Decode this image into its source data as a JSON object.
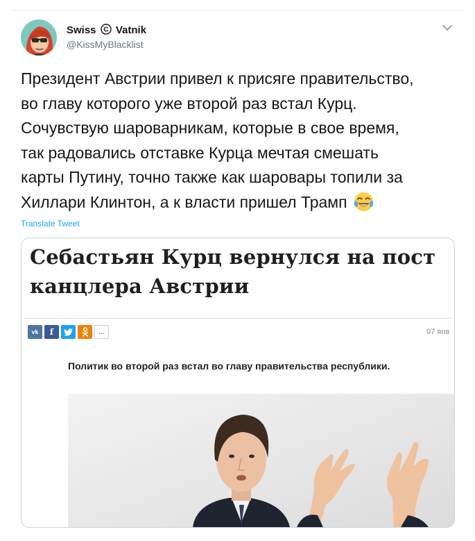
{
  "tweet": {
    "author_name_left": "Swiss",
    "author_copyright": "C",
    "author_name_right": "Vatnik",
    "handle": "@KissMyBlacklist",
    "text_lines": [
      "Президент Австрии привел к присяге правительство,",
      "во главу которого уже второй раз встал Курц.",
      "Сочувствую шароварникам, которые в свое время,",
      "так радовались отставке Курца мечтая смешать",
      "карты Путину, точно также как шаровары топили за",
      "Хиллари Клинтон, а к власти пришел Трамп"
    ],
    "emoji": "face-with-tears-of-joy",
    "translate_label": "Translate Tweet"
  },
  "card": {
    "headline_lines": [
      "Себастьян Курц вернулся на пост",
      "канцлера Австрии"
    ],
    "share_buttons": [
      "vk",
      "f",
      "tw",
      "ok",
      "..."
    ],
    "date": "07 янв",
    "subtitle": "Политик во второй раз встал во главу правительства республики."
  },
  "icons": {
    "menu": "chevron-down-icon",
    "avatar": "cartoon-avatar-red-hair-sunglasses"
  },
  "colors": {
    "link": "#1da1f2",
    "secondary_text": "#657786",
    "border": "#ccd6dd",
    "vk": "#4c75a3",
    "facebook": "#3b5998",
    "twitter": "#1da1f2",
    "odnoklassniki": "#ee8208"
  }
}
